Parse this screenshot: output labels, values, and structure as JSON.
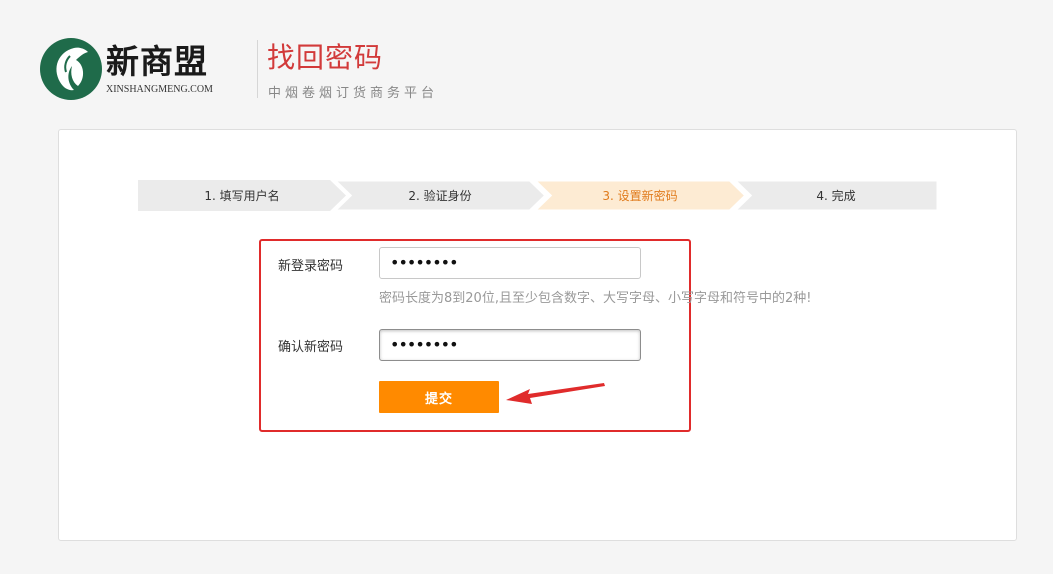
{
  "header": {
    "logo_name": "新商盟",
    "logo_domain": "XINSHANGMENG.COM",
    "title": "找回密码",
    "subtitle": "中烟卷烟订货商务平台"
  },
  "steps": [
    {
      "label": "1. 填写用户名",
      "state": "done"
    },
    {
      "label": "2. 验证身份",
      "state": "done"
    },
    {
      "label": "3. 设置新密码",
      "state": "active"
    },
    {
      "label": "4. 完成",
      "state": "pending"
    }
  ],
  "form": {
    "new_password_label": "新登录密码",
    "new_password_value": "••••••••",
    "hint": "密码长度为8到20位,且至少包含数字、大写字母、小写字母和符号中的2种!",
    "confirm_label": "确认新密码",
    "confirm_value": "••••••••",
    "submit_label": "提交"
  },
  "colors": {
    "brand_green": "#1f6b4a",
    "title_red": "#d23a3a",
    "step_active_bg": "#fdebd3",
    "step_bg": "#ebebeb",
    "button": "#ff8a00",
    "annotation_red": "#e02b2b"
  },
  "icons": {
    "logo": "leaf-logo-icon",
    "annotation": "red-arrow-icon"
  }
}
